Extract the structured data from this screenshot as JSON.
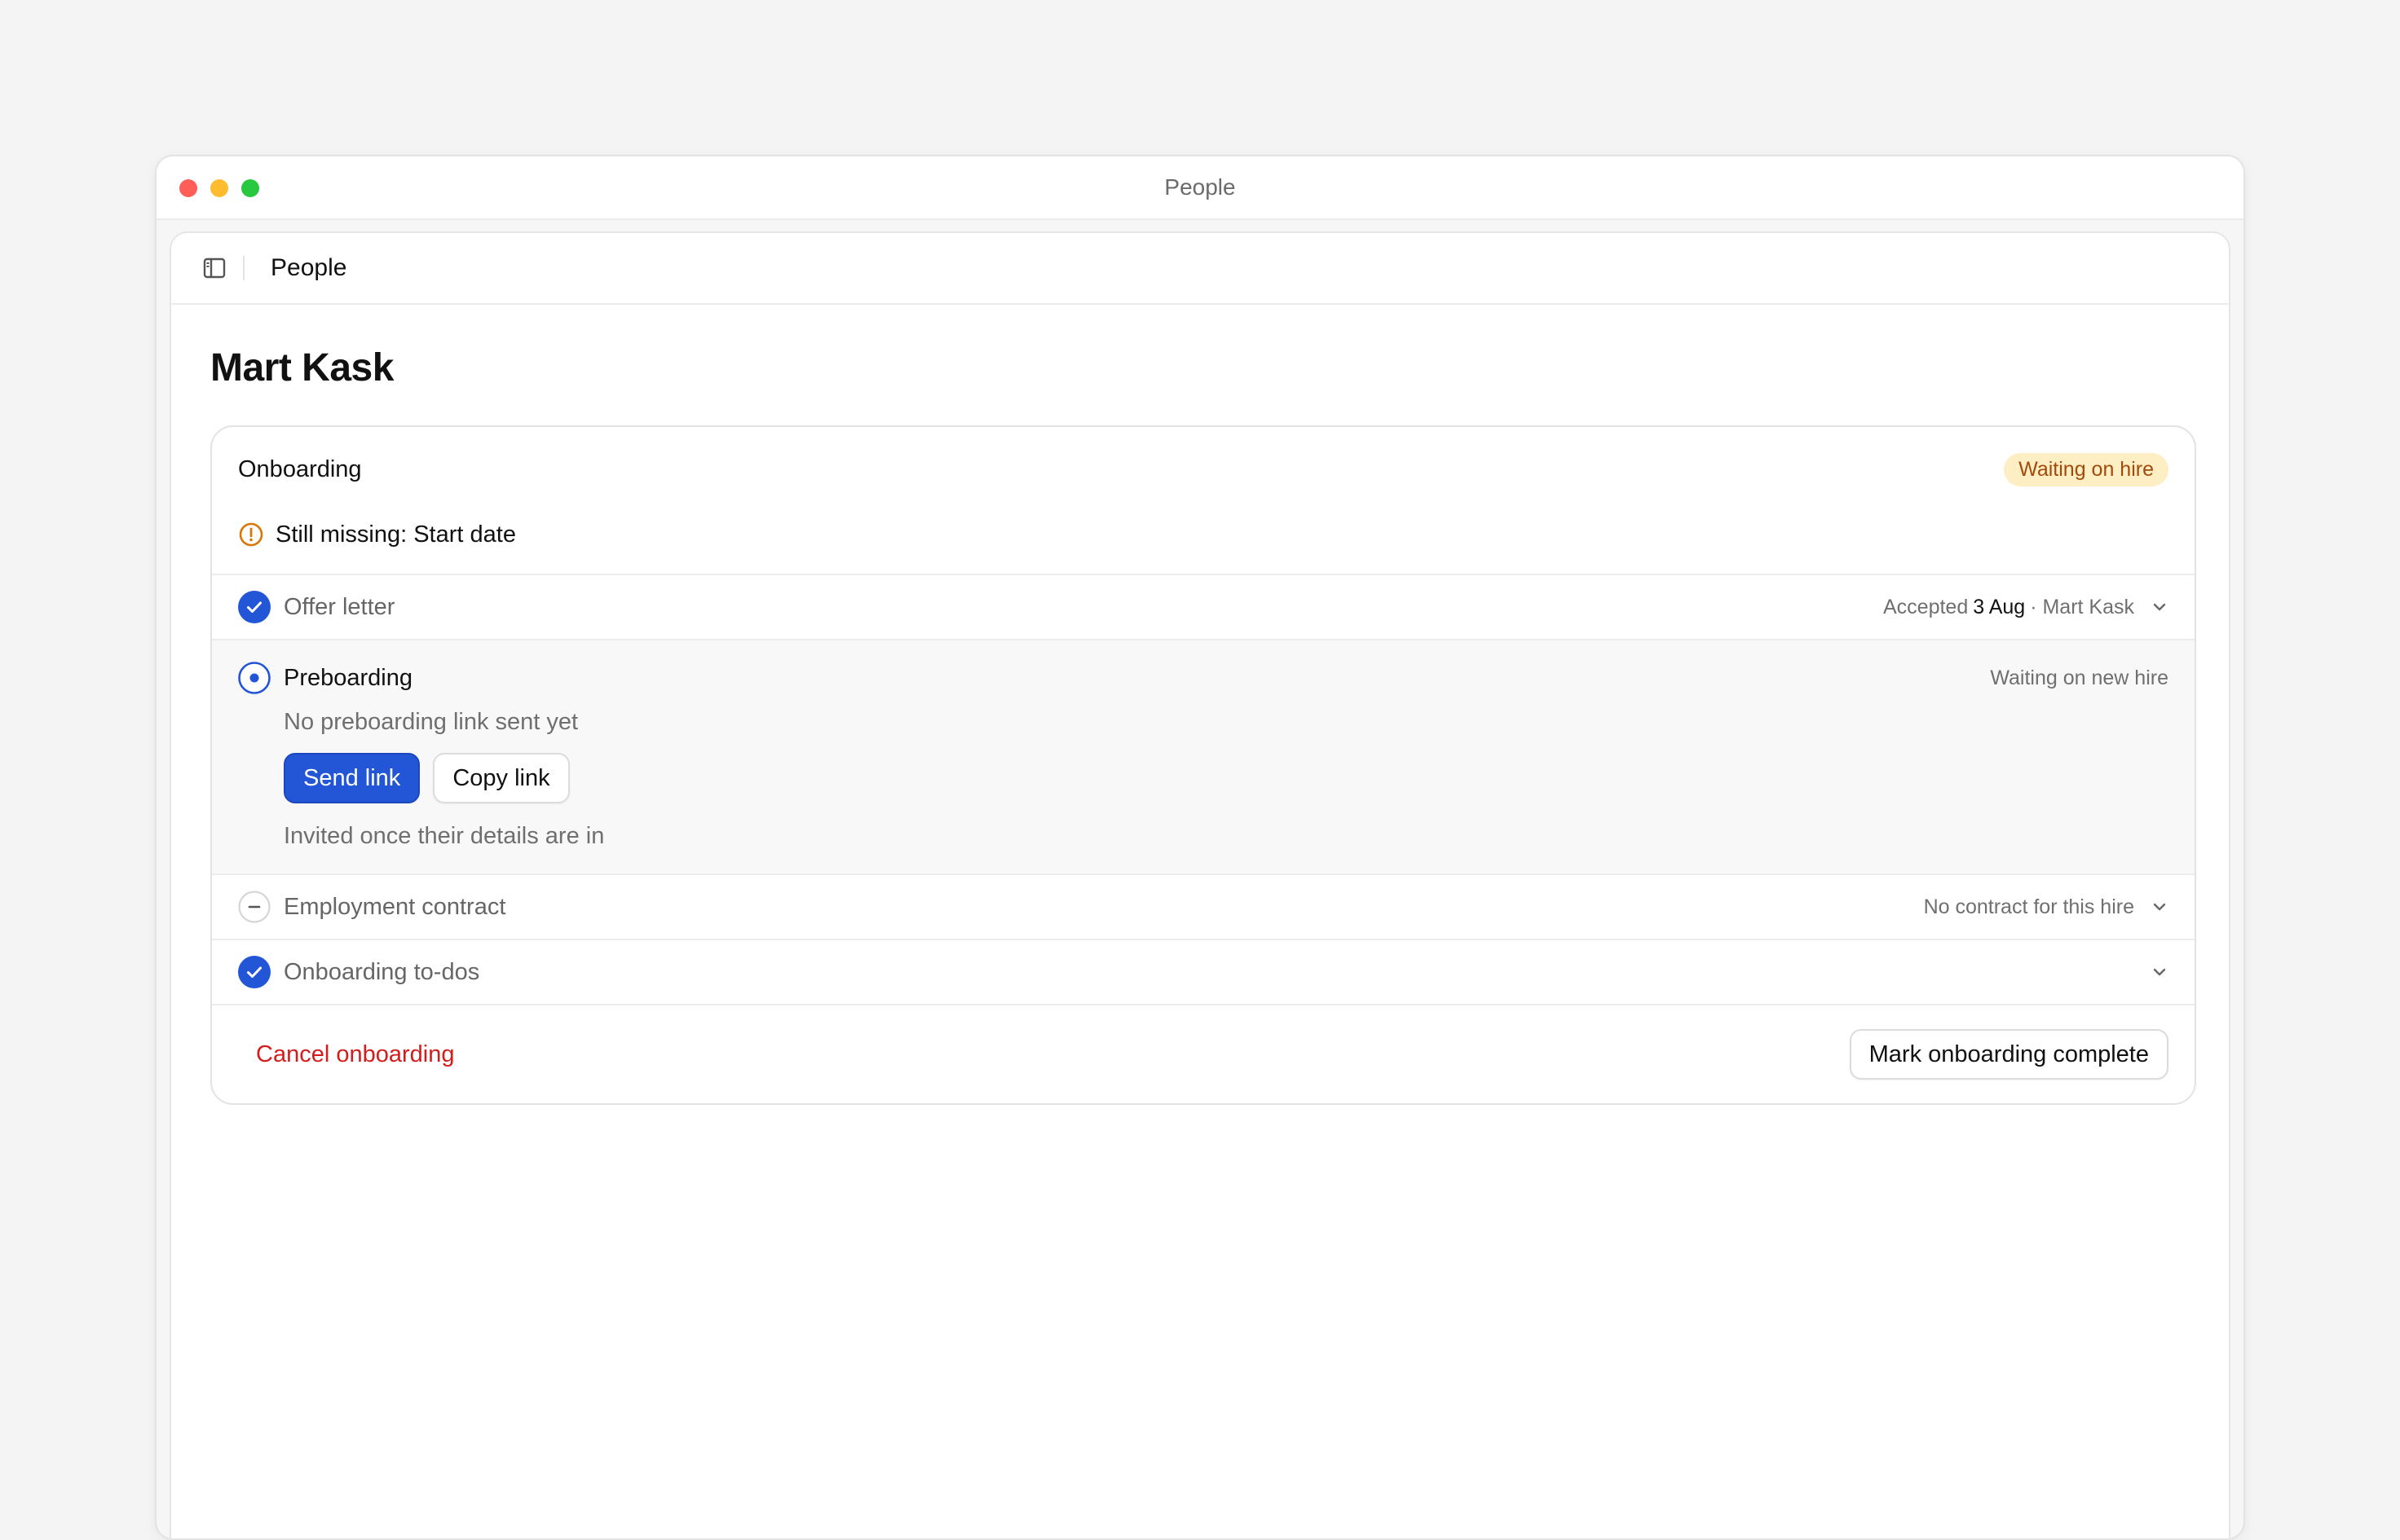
{
  "window": {
    "title": "People"
  },
  "toolbar": {
    "breadcrumb": "People",
    "sidebar_icon": "sidebar-icon"
  },
  "page": {
    "title": "Mart Kask"
  },
  "onboarding": {
    "title": "Onboarding",
    "badge": "Waiting on hire",
    "missing_text": "Still missing: Start date",
    "steps": [
      {
        "label": "Offer letter",
        "status": "done",
        "meta_prefix": "Accepted",
        "meta_date": "3 Aug",
        "meta_suffix": "· Mart Kask"
      },
      {
        "label": "Preboarding",
        "status": "in-progress",
        "meta": "Waiting on new hire",
        "hint": "No preboarding link sent yet",
        "primary_action": "Send link",
        "secondary_action": "Copy link",
        "note": "Invited once their details are in"
      },
      {
        "label": "Employment contract",
        "status": "skipped",
        "meta": "No contract for this hire"
      },
      {
        "label": "Onboarding to-dos",
        "status": "done"
      }
    ],
    "cancel_label": "Cancel onboarding",
    "complete_label": "Mark onboarding complete"
  },
  "colors": {
    "accent": "#2356d6",
    "danger": "#d31d1d",
    "warning": "#d97706",
    "badge_bg": "#fdefc3",
    "badge_text": "#a14a0b"
  }
}
